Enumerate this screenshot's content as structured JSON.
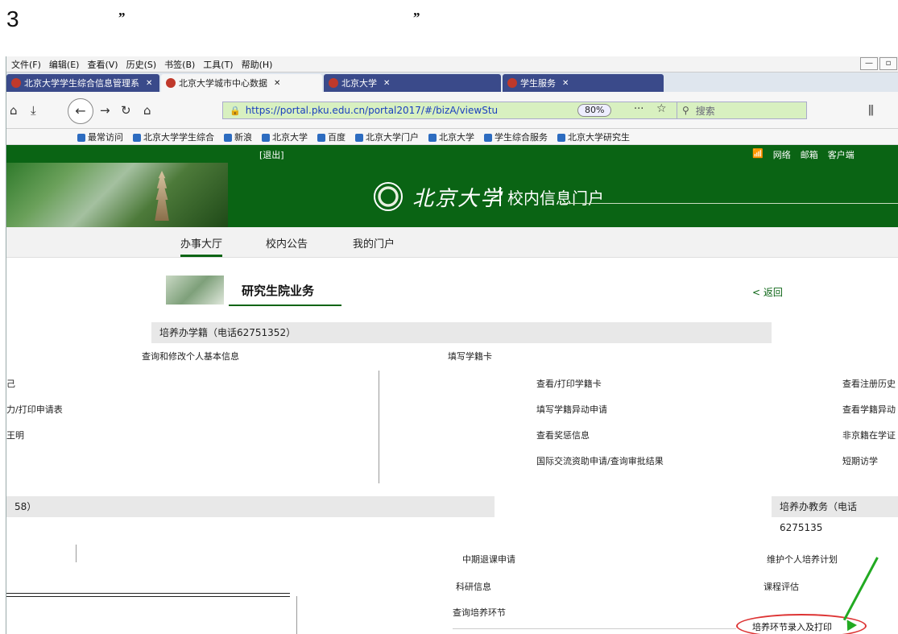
{
  "doc": {
    "step": "3",
    "quote_open": "”",
    "quote_close": "”"
  },
  "menubar": {
    "items": [
      "文件(F)",
      "编辑(E)",
      "查看(V)",
      "历史(S)",
      "书签(B)",
      "工具(T)",
      "帮助(H)"
    ]
  },
  "tabs": [
    {
      "label": "北京大学学生综合信息管理系",
      "active": false
    },
    {
      "label": "北京大学城市中心数据",
      "active": true
    },
    {
      "label": "北京大学",
      "active": false
    },
    {
      "label": "学生服务",
      "active": false
    }
  ],
  "address": {
    "url": "https://portal.pku.edu.cn/portal2017/#/bizA/viewStu",
    "zoom": "80%",
    "search_placeholder": "搜索"
  },
  "bookmarks": [
    "最常访问",
    "北京大学学生综合",
    "新浪",
    "北京大学",
    "百度",
    "北京大学门户",
    "北京大学",
    "学生综合服务",
    "北京大学研究生"
  ],
  "portal": {
    "logout": "[退出]",
    "top_links": [
      "网络",
      "邮箱",
      "客户端"
    ],
    "brand_name": "北京大学",
    "portal_name": "校内信息门户"
  },
  "nav": {
    "tabs": [
      "办事大厅",
      "校内公告",
      "我的门户"
    ]
  },
  "section": {
    "title": "研究生院业务",
    "back": "< 返回"
  },
  "groups": {
    "xueji": "培养办学籍（电话62751352）",
    "jiaowu_left": "58）",
    "jiaowu_right": "培养办教务（电话6275135"
  },
  "links": {
    "partial_top_1": "查询和修改个人基本信息",
    "partial_top_2": "填写学籍卡",
    "col3": [
      "查看/打印学籍卡",
      "填写学籍异动申请",
      "查看奖惩信息",
      "国际交流资助申请/查询审批结果"
    ],
    "col1": [
      "己",
      "力/打印申请表",
      "王明"
    ],
    "col4": [
      "查看注册历史",
      "查看学籍异动",
      "非京籍在学证",
      "短期访学"
    ],
    "row2_mid": [
      "中期退课申请",
      "科研信息",
      "查询培养环节"
    ],
    "row2_right": [
      "维护个人培养计划",
      "课程评估",
      "培养环节录入及打印"
    ]
  }
}
